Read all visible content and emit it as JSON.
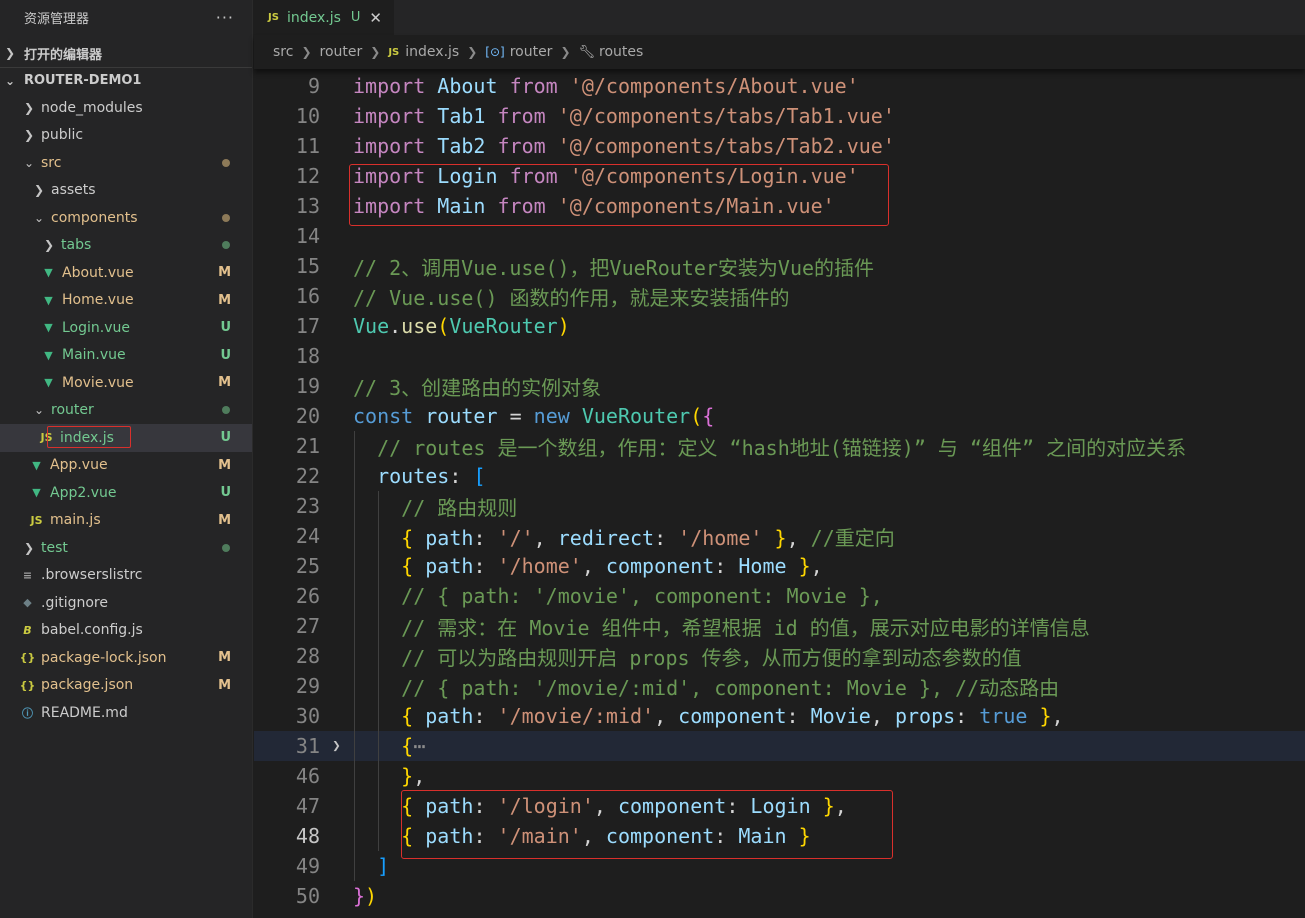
{
  "sidebar": {
    "title": "资源管理器",
    "more_label": "···",
    "open_editors_label": "打开的编辑器",
    "project_label": "ROUTER-DEMO1",
    "tree": [
      {
        "label": "node_modules",
        "badge": ""
      },
      {
        "label": "public",
        "badge": ""
      },
      {
        "label": "src",
        "badge": ""
      },
      {
        "label": "assets",
        "badge": ""
      },
      {
        "label": "components",
        "badge": ""
      },
      {
        "label": "tabs",
        "badge": ""
      },
      {
        "label": "About.vue",
        "badge": "M"
      },
      {
        "label": "Home.vue",
        "badge": "M"
      },
      {
        "label": "Login.vue",
        "badge": "U"
      },
      {
        "label": "Main.vue",
        "badge": "U"
      },
      {
        "label": "Movie.vue",
        "badge": "M"
      },
      {
        "label": "router",
        "badge": ""
      },
      {
        "label": "index.js",
        "badge": "U"
      },
      {
        "label": "App.vue",
        "badge": "M"
      },
      {
        "label": "App2.vue",
        "badge": "U"
      },
      {
        "label": "main.js",
        "badge": "M"
      },
      {
        "label": "test",
        "badge": ""
      },
      {
        "label": ".browserslistrc",
        "badge": ""
      },
      {
        "label": ".gitignore",
        "badge": ""
      },
      {
        "label": "babel.config.js",
        "badge": ""
      },
      {
        "label": "package-lock.json",
        "badge": "M"
      },
      {
        "label": "package.json",
        "badge": "M"
      },
      {
        "label": "README.md",
        "badge": ""
      }
    ]
  },
  "tab": {
    "icon": "JS",
    "name": "index.js",
    "state": "U",
    "close": "✕"
  },
  "breadcrumb": [
    "src",
    "router",
    "index.js",
    "router",
    "routes"
  ],
  "colors": {
    "modified": "#e2c08d",
    "untracked": "#73c991",
    "highlight_box": "#d9302c",
    "editor_bg": "#1e1e1e",
    "sidebar_bg": "#252526"
  },
  "code": {
    "line_numbers": [
      "9",
      "10",
      "11",
      "12",
      "13",
      "14",
      "15",
      "16",
      "17",
      "18",
      "19",
      "20",
      "21",
      "22",
      "23",
      "24",
      "25",
      "26",
      "27",
      "28",
      "29",
      "30",
      "31",
      "46",
      "47",
      "48",
      "49",
      "50"
    ],
    "t": {
      "import": "import",
      "from": "from",
      "About": "About",
      "Tab1": "Tab1",
      "Tab2": "Tab2",
      "Login": "Login",
      "Main": "Main",
      "s_about": "'@/components/About.vue'",
      "s_tab1": "'@/components/tabs/Tab1.vue'",
      "s_tab2": "'@/components/tabs/Tab2.vue'",
      "s_login": "'@/components/Login.vue'",
      "s_main": "'@/components/Main.vue'",
      "c15": "// 2、调用Vue.use()，把VueRouter安装为Vue的插件",
      "c16": "// Vue.use() 函数的作用，就是来安装插件的",
      "Vue": "Vue",
      "use": "use",
      "VueRouter": "VueRouter",
      "c19": "// 3、创建路由的实例对象",
      "const": "const",
      "router": "router",
      "new": "new",
      "c21": "// routes 是一个数组，作用：定义 “hash地址(锚链接)” 与 “组件” 之间的对应关系",
      "routes": "routes",
      "c23": "// 路由规则",
      "path": "path",
      "redirect": "redirect",
      "component": "component",
      "props": "props",
      "true": "true",
      "s_root": "'/'",
      "s_home": "'/home'",
      "Home": "Home",
      "c24": "//重定向",
      "c26": "// { path: '/movie', component: Movie },",
      "c27": "// 需求：在 Movie 组件中，希望根据 id 的值，展示对应电影的详情信息",
      "c28": "// 可以为路由规则开启 props 传参，从而方便的拿到动态参数的值",
      "c29": "// { path: '/movie/:mid', component: Movie }, //动态路由",
      "s_movie_mid": "'/movie/:mid'",
      "Movie": "Movie",
      "ellipsis": "⋯",
      "s_login_path": "'/login'",
      "s_main_path": "'/main'"
    }
  }
}
